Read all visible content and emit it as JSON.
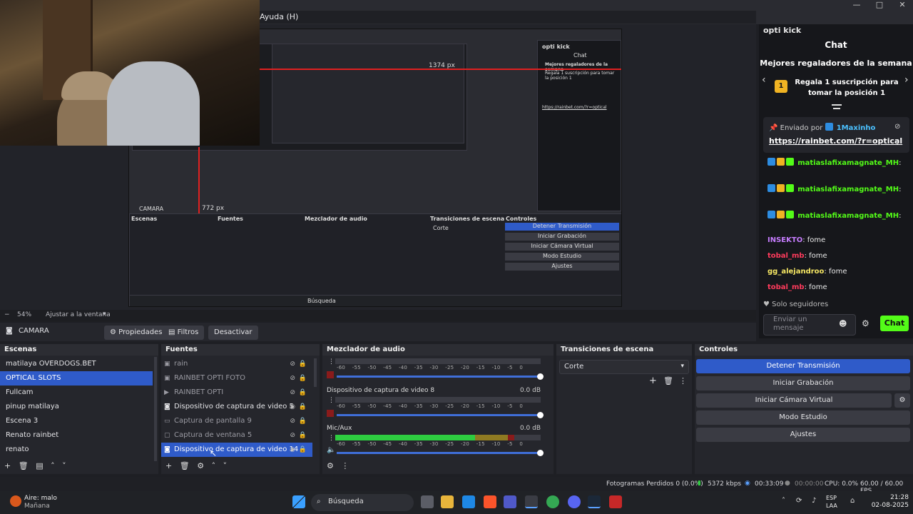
{
  "menu": {
    "help": "Ayuda (H)"
  },
  "window_controls": {
    "minimize": "—",
    "maximize": "□",
    "close": "✕"
  },
  "preview": {
    "inner_title": "opti kick",
    "px_label_1": "1374 px",
    "px_label_2": "772 px",
    "inner_chat": "Chat",
    "inner_gifters": "Mejores regaladores de la semana",
    "inner_gift_msg": "Regala 1 suscripción para tomar la posición 1",
    "inner_link": "https://rainbet.com/?r=optical",
    "inner_camera": "CAMARA",
    "inner_stop": "Detener Transmisión",
    "inner_rec": "Iniciar Grabación",
    "inner_vcam": "Iniciar Cámara Virtual",
    "inner_studio": "Modo Estudio",
    "inner_settings": "Ajustes",
    "inner_transitions": "Transiciones de escena",
    "inner_cut": "Corte",
    "inner_controls": "Controles",
    "inner_scenes": "Escenas",
    "inner_sources": "Fuentes",
    "inner_mixer": "Mezclador de audio",
    "inner_search": "Búsqueda"
  },
  "chat": {
    "channel": "opti kick",
    "title": "Chat",
    "gifters_title": "Mejores regaladores de la semana",
    "gift_rank": "1",
    "gift_message": "Regala 1 suscripción para tomar la posición 1",
    "pinned_by_label": "Enviado por",
    "pinned_user": "1Maxinho",
    "pinned_link": "https://rainbet.com/?r=optical",
    "messages": [
      {
        "user": "matiaslafixamagnate_MH",
        "text": ":",
        "color": "#53fc18"
      },
      {
        "user": "matiaslafixamagnate_MH",
        "text": ":",
        "color": "#53fc18"
      },
      {
        "user": "matiaslafixamagnate_MH",
        "text": ":",
        "color": "#53fc18"
      },
      {
        "user": "INSEKTO",
        "text": ": fome",
        "color": "#c77dff"
      },
      {
        "user": "tobal_mb",
        "text": ": fome",
        "color": "#ff3b5c"
      },
      {
        "user": "gg_alejandroo",
        "text": ": fome",
        "color": "#f5e663"
      },
      {
        "user": "tobal_mb",
        "text": ": fome",
        "color": "#ff3b5c"
      }
    ],
    "follow_only": "Solo seguidores",
    "input_placeholder": "Enviar un mensaje",
    "send_label": "Chat"
  },
  "zoom": {
    "value": "54%",
    "fit_label": "Ajustar a la ventana"
  },
  "source_toolbar": {
    "source_name": "CAMARA",
    "properties": "Propiedades",
    "filters": "Filtros",
    "deactivate": "Desactivar"
  },
  "scenes": {
    "title": "Escenas",
    "items": [
      "matilaya OVERDOGS.BET",
      "OPTICAL SLOTS",
      "Fullcam",
      "pinup matilaya",
      "Escena 3",
      "Renato rainbet",
      "renato"
    ],
    "selected_index": 1
  },
  "sources": {
    "title": "Fuentes",
    "items": [
      {
        "name": "rain",
        "icon": "image-icon",
        "visible": false,
        "dim": true
      },
      {
        "name": "RAINBET OPTI FOTO",
        "icon": "image-icon",
        "visible": false,
        "dim": true
      },
      {
        "name": "RAINBET OPTI",
        "icon": "play-icon",
        "visible": false,
        "dim": true
      },
      {
        "name": "Dispositivo de captura de video 5",
        "icon": "camera-icon",
        "visible": true,
        "dim": false
      },
      {
        "name": "Captura de pantalla 9",
        "icon": "monitor-icon",
        "visible": false,
        "dim": true
      },
      {
        "name": "Captura de ventana 5",
        "icon": "window-icon",
        "visible": false,
        "dim": true
      },
      {
        "name": "Dispositivo de captura de video 14",
        "icon": "camera-icon",
        "visible": true,
        "dim": false
      }
    ],
    "selected_index": 6
  },
  "mixer": {
    "title": "Mezclador de audio",
    "ticks": [
      "-60",
      "-55",
      "-50",
      "-45",
      "-40",
      "-35",
      "-30",
      "-25",
      "-20",
      "-15",
      "-10",
      "-5",
      "0"
    ],
    "channels": [
      {
        "name": "",
        "db": "",
        "level": 0
      },
      {
        "name": "Dispositivo de captura de video 8",
        "db": "0.0 dB",
        "level": 0
      },
      {
        "name": "Mic/Aux",
        "db": "0.0 dB",
        "level": 0.87
      }
    ]
  },
  "transitions": {
    "title": "Transiciones de escena",
    "selected": "Corte"
  },
  "controls": {
    "title": "Controles",
    "stop_stream": "Detener Transmisión",
    "start_recording": "Iniciar Grabación",
    "start_virtual_cam": "Iniciar Cámara Virtual",
    "studio_mode": "Modo Estudio",
    "settings": "Ajustes"
  },
  "status": {
    "dropped_frames": "Fotogramas Perdidos 0 (0.0%)",
    "bitrate": "5372 kbps",
    "stream_time": "00:33:09",
    "rec_time": "00:00:00",
    "cpu": "CPU: 0.0%",
    "fps": "60.00 / 60.00 FPS"
  },
  "taskbar": {
    "weather_title": "Aire: malo",
    "weather_sub": "Mañana",
    "search_placeholder": "Búsqueda",
    "lang_1": "ESP",
    "lang_2": "LAA",
    "time": "21:28",
    "date": "02-08-2025"
  },
  "colors": {
    "accent": "#2f5bc9",
    "kick_green": "#53fc18",
    "record_red": "#e02020"
  }
}
